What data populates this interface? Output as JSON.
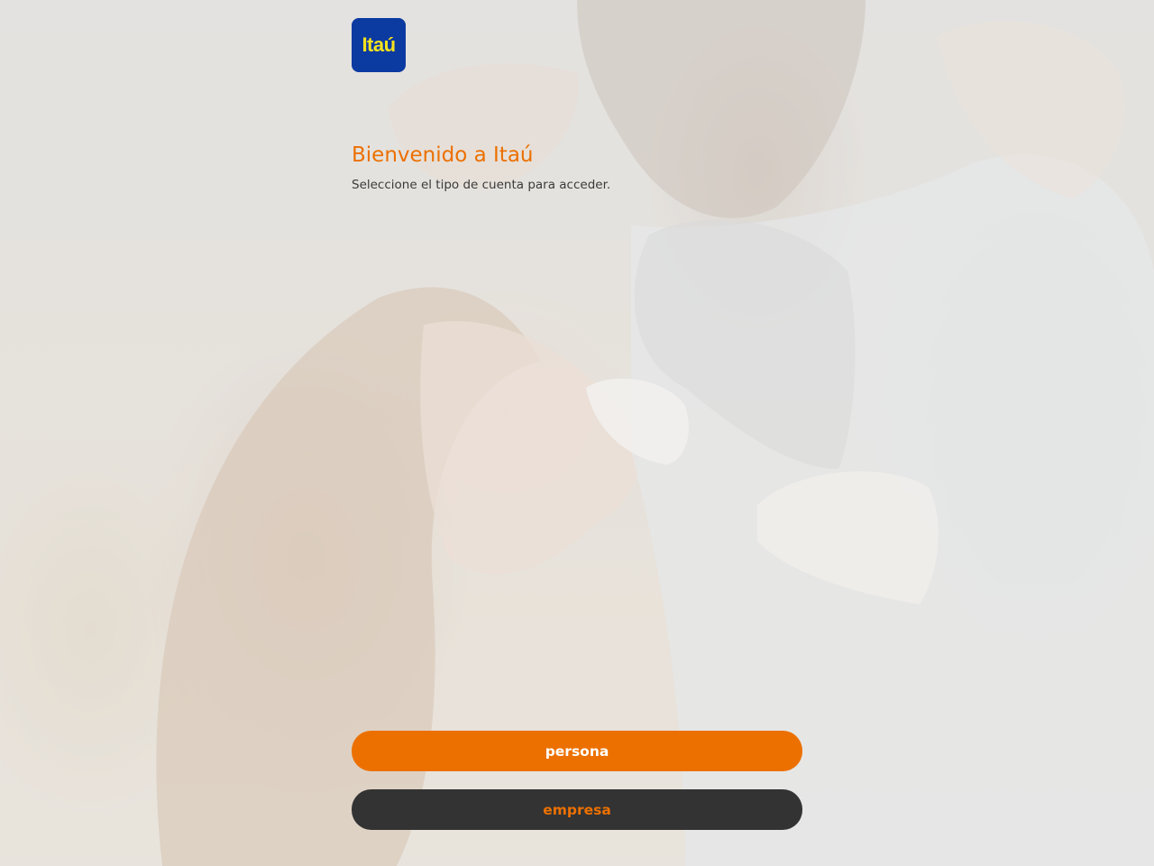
{
  "brand": {
    "logo_text": "Itaú",
    "logo_bg": "#0b3aa1",
    "logo_fg": "#f5e21d",
    "accent": "#ec7000",
    "dark": "#333333"
  },
  "header": {
    "title": "Bienvenido a Itaú",
    "subtitle": "Seleccione el tipo de cuenta para acceder."
  },
  "actions": {
    "persona_label": "persona",
    "empresa_label": "empresa"
  },
  "background": {
    "image": "family-photo"
  }
}
